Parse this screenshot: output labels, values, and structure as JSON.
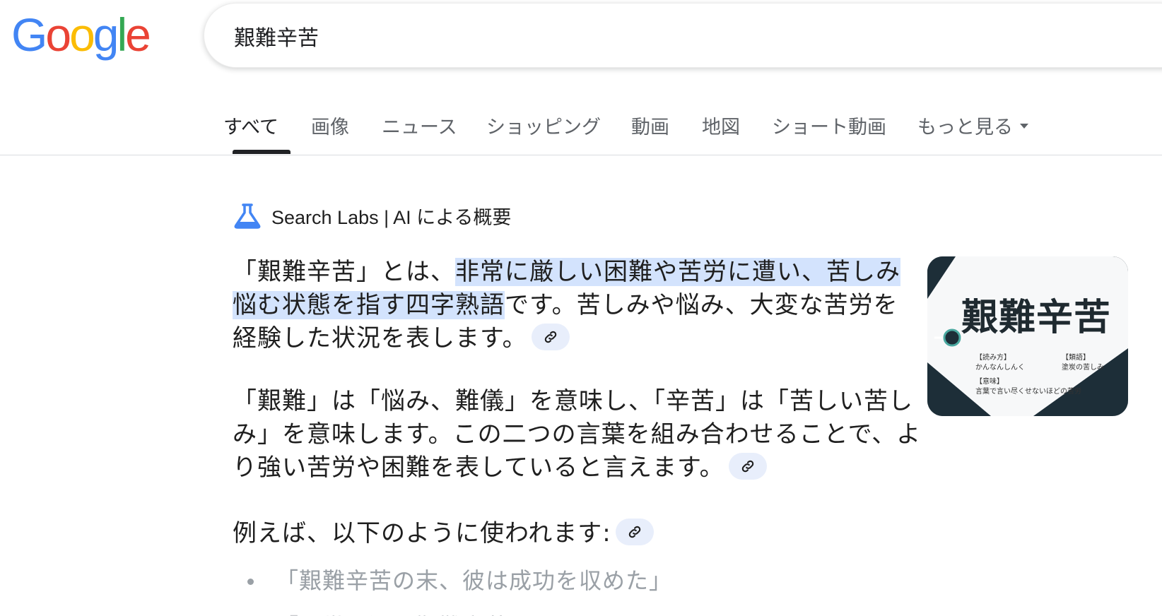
{
  "logo": {
    "letters": [
      "G",
      "o",
      "o",
      "g",
      "l",
      "e"
    ],
    "colors": [
      "#4285F4",
      "#EA4335",
      "#FBBC05",
      "#4285F4",
      "#34A853",
      "#EA4335"
    ]
  },
  "search": {
    "query": "艱難辛苦"
  },
  "tabs": [
    {
      "label": "すべて",
      "active": true
    },
    {
      "label": "画像"
    },
    {
      "label": "ニュース"
    },
    {
      "label": "ショッピング"
    },
    {
      "label": "動画"
    },
    {
      "label": "地図"
    },
    {
      "label": "ショート動画"
    },
    {
      "label": "もっと見る"
    }
  ],
  "ai_overview": {
    "icon": "flask-icon",
    "header": "Search Labs | AI による概要",
    "p1": {
      "before": "「艱難辛苦」とは、",
      "highlight": "非常に厳しい困難や苦労に遭い、苦しみ悩む状態を指す四字熟語",
      "after": "です。苦しみや悩み、大変な苦労を経験した状況を表します。"
    },
    "p2": "「艱難」は「悩み、難儀」を意味し、「辛苦」は「苦しい苦しみ」を意味します。この二つの言葉を組み合わせることで、より強い苦労や困難を表していると言えます。",
    "p3": "例えば、以下のように使われます:",
    "bullets": [
      "「艱難辛苦の末、彼は成功を収めた」"
    ],
    "cut_off": "「三世の辺の艱難辛苦をもたらされた」",
    "citation_icon": "link-icon",
    "citation_color": "#e8eefb",
    "highlight_color": "#d3e3fd"
  },
  "thumbnail": {
    "title": "艱難辛苦",
    "rows": [
      {
        "label": "【読み方】",
        "value": "かんなんしんく"
      },
      {
        "label": "【類語】",
        "value": "塗炭の苦しみ"
      },
      {
        "label": "【意味】",
        "value": "言葉で言い尽くせないほどの苦労"
      }
    ]
  }
}
